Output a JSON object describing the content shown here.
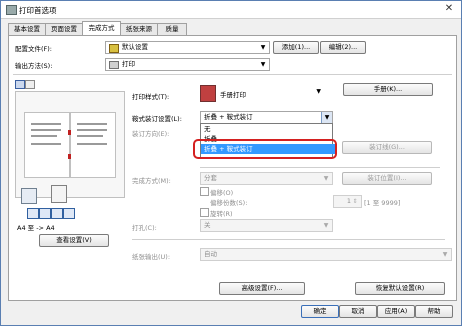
{
  "window": {
    "title": "打印首选项",
    "close": "✕"
  },
  "tabs": [
    "基本设置",
    "页面设置",
    "完成方式",
    "纸张来源",
    "质量"
  ],
  "profile": {
    "label": "配置文件(F):",
    "value": "默认设置",
    "add": "添加(1)...",
    "edit": "编辑(2)..."
  },
  "output": {
    "label": "输出方法(S):",
    "value": "打印"
  },
  "print_style": {
    "label": "打印样式(T):",
    "value": "手册打印"
  },
  "booklet": {
    "label": "鞍式装订设置(L):",
    "value": "折叠 + 鞍式装订",
    "dropdown_options": [
      "无",
      "折叠",
      "折叠 + 鞍式装订"
    ],
    "selected_index": 2
  },
  "manual_button": "手册(K)...",
  "binding_dir": {
    "label": "装订方向(E):"
  },
  "gutter_button": "装订线(G)...",
  "finishing": {
    "label": "完成方式(M):",
    "value": "分套"
  },
  "staple_pos_button": "装订位置(I)...",
  "offset": {
    "label": "偏移(O)",
    "count_label": "偏移份数(S):",
    "count": "1",
    "range": "[1 至 9999]"
  },
  "rotate": {
    "label": "旋转(R)"
  },
  "punch": {
    "label": "打孔(C):",
    "value": "关"
  },
  "paper_output": {
    "label": "纸张输出(U):",
    "value": "自动"
  },
  "page_info": "A4 至 -> A4",
  "view_settings_button": "查看设置(V)",
  "advanced_button": "高级设置(F)...",
  "restore_button": "恢复默认设置(R)",
  "ok_button": "确定",
  "cancel_button": "取消",
  "apply_button": "应用(A)",
  "help_button": "帮助",
  "highlight_color": "#d42020",
  "selection_color": "#3399ff"
}
